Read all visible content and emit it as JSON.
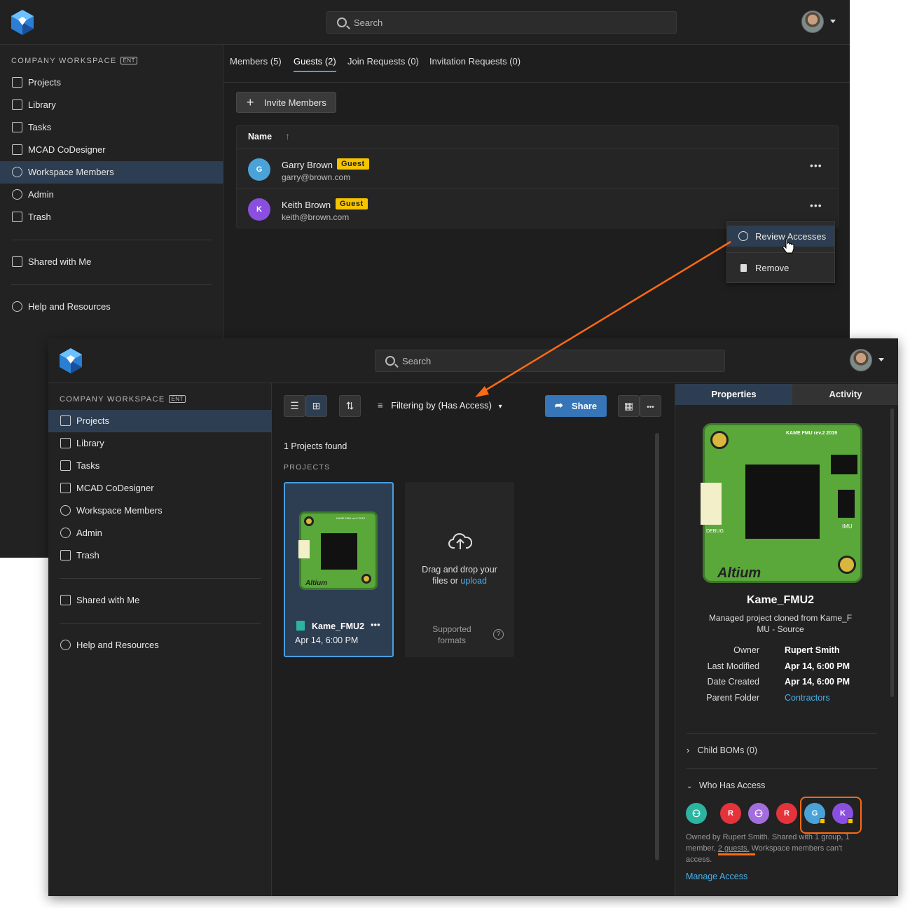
{
  "back_window": {
    "search": {
      "placeholder": "Search"
    },
    "workspace": {
      "title": "COMPANY WORKSPACE",
      "badge": "ENT"
    },
    "sidebar": {
      "items": [
        {
          "label": "Projects",
          "icon": "folder-icon"
        },
        {
          "label": "Library",
          "icon": "library-icon"
        },
        {
          "label": "Tasks",
          "icon": "tasks-icon"
        },
        {
          "label": "MCAD CoDesigner",
          "icon": "mcad-icon"
        },
        {
          "label": "Workspace Members",
          "icon": "members-icon",
          "active": true
        },
        {
          "label": "Admin",
          "icon": "admin-icon"
        },
        {
          "label": "Trash",
          "icon": "trash-icon"
        }
      ],
      "shared": "Shared with Me",
      "help": "Help and Resources"
    },
    "tabs": [
      {
        "label": "Members",
        "count": "(5)"
      },
      {
        "label": "Guests",
        "count": "(2)",
        "active": true
      },
      {
        "label": "Join Requests",
        "count": "(0)"
      },
      {
        "label": "Invitation Requests",
        "count": "(0)"
      }
    ],
    "invite_button": "Invite Members",
    "table": {
      "header": "Name",
      "rows": [
        {
          "initial": "G",
          "name": "Garry Brown",
          "badge": "Guest",
          "email": "garry@brown.com",
          "color": "#4aa3d8"
        },
        {
          "initial": "K",
          "name": "Keith Brown",
          "badge": "Guest",
          "email": "keith@brown.com",
          "color": "#8a4fe0"
        }
      ]
    },
    "context_menu": {
      "items": [
        {
          "label": "Review Accesses",
          "icon": "user-circle-icon"
        },
        {
          "label": "Remove",
          "icon": "trash-icon"
        }
      ]
    }
  },
  "front_window": {
    "search": {
      "placeholder": "Search"
    },
    "workspace": {
      "title": "COMPANY WORKSPACE",
      "badge": "ENT"
    },
    "sidebar": {
      "items": [
        {
          "label": "Projects",
          "active": true
        },
        {
          "label": "Library"
        },
        {
          "label": "Tasks"
        },
        {
          "label": "MCAD CoDesigner"
        },
        {
          "label": "Workspace Members"
        },
        {
          "label": "Admin"
        },
        {
          "label": "Trash"
        }
      ],
      "shared": "Shared with Me",
      "help": "Help and Resources"
    },
    "toolbar": {
      "filter_label": "Filtering by (Has Access)",
      "share_label": "Share"
    },
    "results": {
      "count_text": "1 Projects found",
      "section_title": "PROJECTS"
    },
    "project_card": {
      "name": "Kame_FMU2",
      "date": "Apr 14, 6:00 PM",
      "board_label": "KAME FMU rev.2 2019",
      "brand": "Altium"
    },
    "upload_card": {
      "text_line1": "Drag and drop your",
      "text_line2_prefix": "files or",
      "text_link": "upload",
      "supported_line1": "Supported",
      "supported_line2": "formats"
    },
    "properties": {
      "tabs": [
        "Properties",
        "Activity"
      ],
      "board_label": "KAME FMU rev.2 2019",
      "brand": "Altium",
      "silk_imu": "IMU",
      "silk_debug": "DEBUG",
      "title": "Kame_FMU2",
      "description_line1": "Managed project cloned from Kame_F",
      "description_line2": "MU - Source",
      "fields": [
        {
          "label": "Owner",
          "value": "Rupert Smith"
        },
        {
          "label": "Last Modified",
          "value": "Apr 14, 6:00 PM"
        },
        {
          "label": "Date Created",
          "value": "Apr 14, 6:00 PM"
        },
        {
          "label": "Parent Folder",
          "value": "Contractors",
          "link": true
        }
      ],
      "child_boms": "Child BOMs (0)",
      "who_has_access": "Who Has Access",
      "access_avatars": [
        {
          "initial": "",
          "type": "group",
          "color": "#2bb5a0"
        },
        {
          "initial": "R",
          "type": "user",
          "color": "#e5333b"
        },
        {
          "initial": "",
          "type": "group",
          "color": "#a46ddf"
        },
        {
          "initial": "R",
          "type": "user",
          "color": "#e5333b"
        },
        {
          "initial": "G",
          "type": "guest",
          "color": "#4aa3d8"
        },
        {
          "initial": "K",
          "type": "guest",
          "color": "#8a4fe0"
        }
      ],
      "access_summary_1": "Owned by Rupert Smith. Shared with 1 group, 1",
      "access_summary_2a": "member,",
      "access_summary_2b": "2 guests.",
      "access_summary_2c": "Workspace members can't",
      "access_summary_3": "access.",
      "manage_access": "Manage Access"
    }
  },
  "colors": {
    "highlight_orange": "#ff6a13",
    "accent_blue": "#4ab0ea",
    "guest_badge": "#f5c400",
    "active_nav": "#2e3e52"
  }
}
